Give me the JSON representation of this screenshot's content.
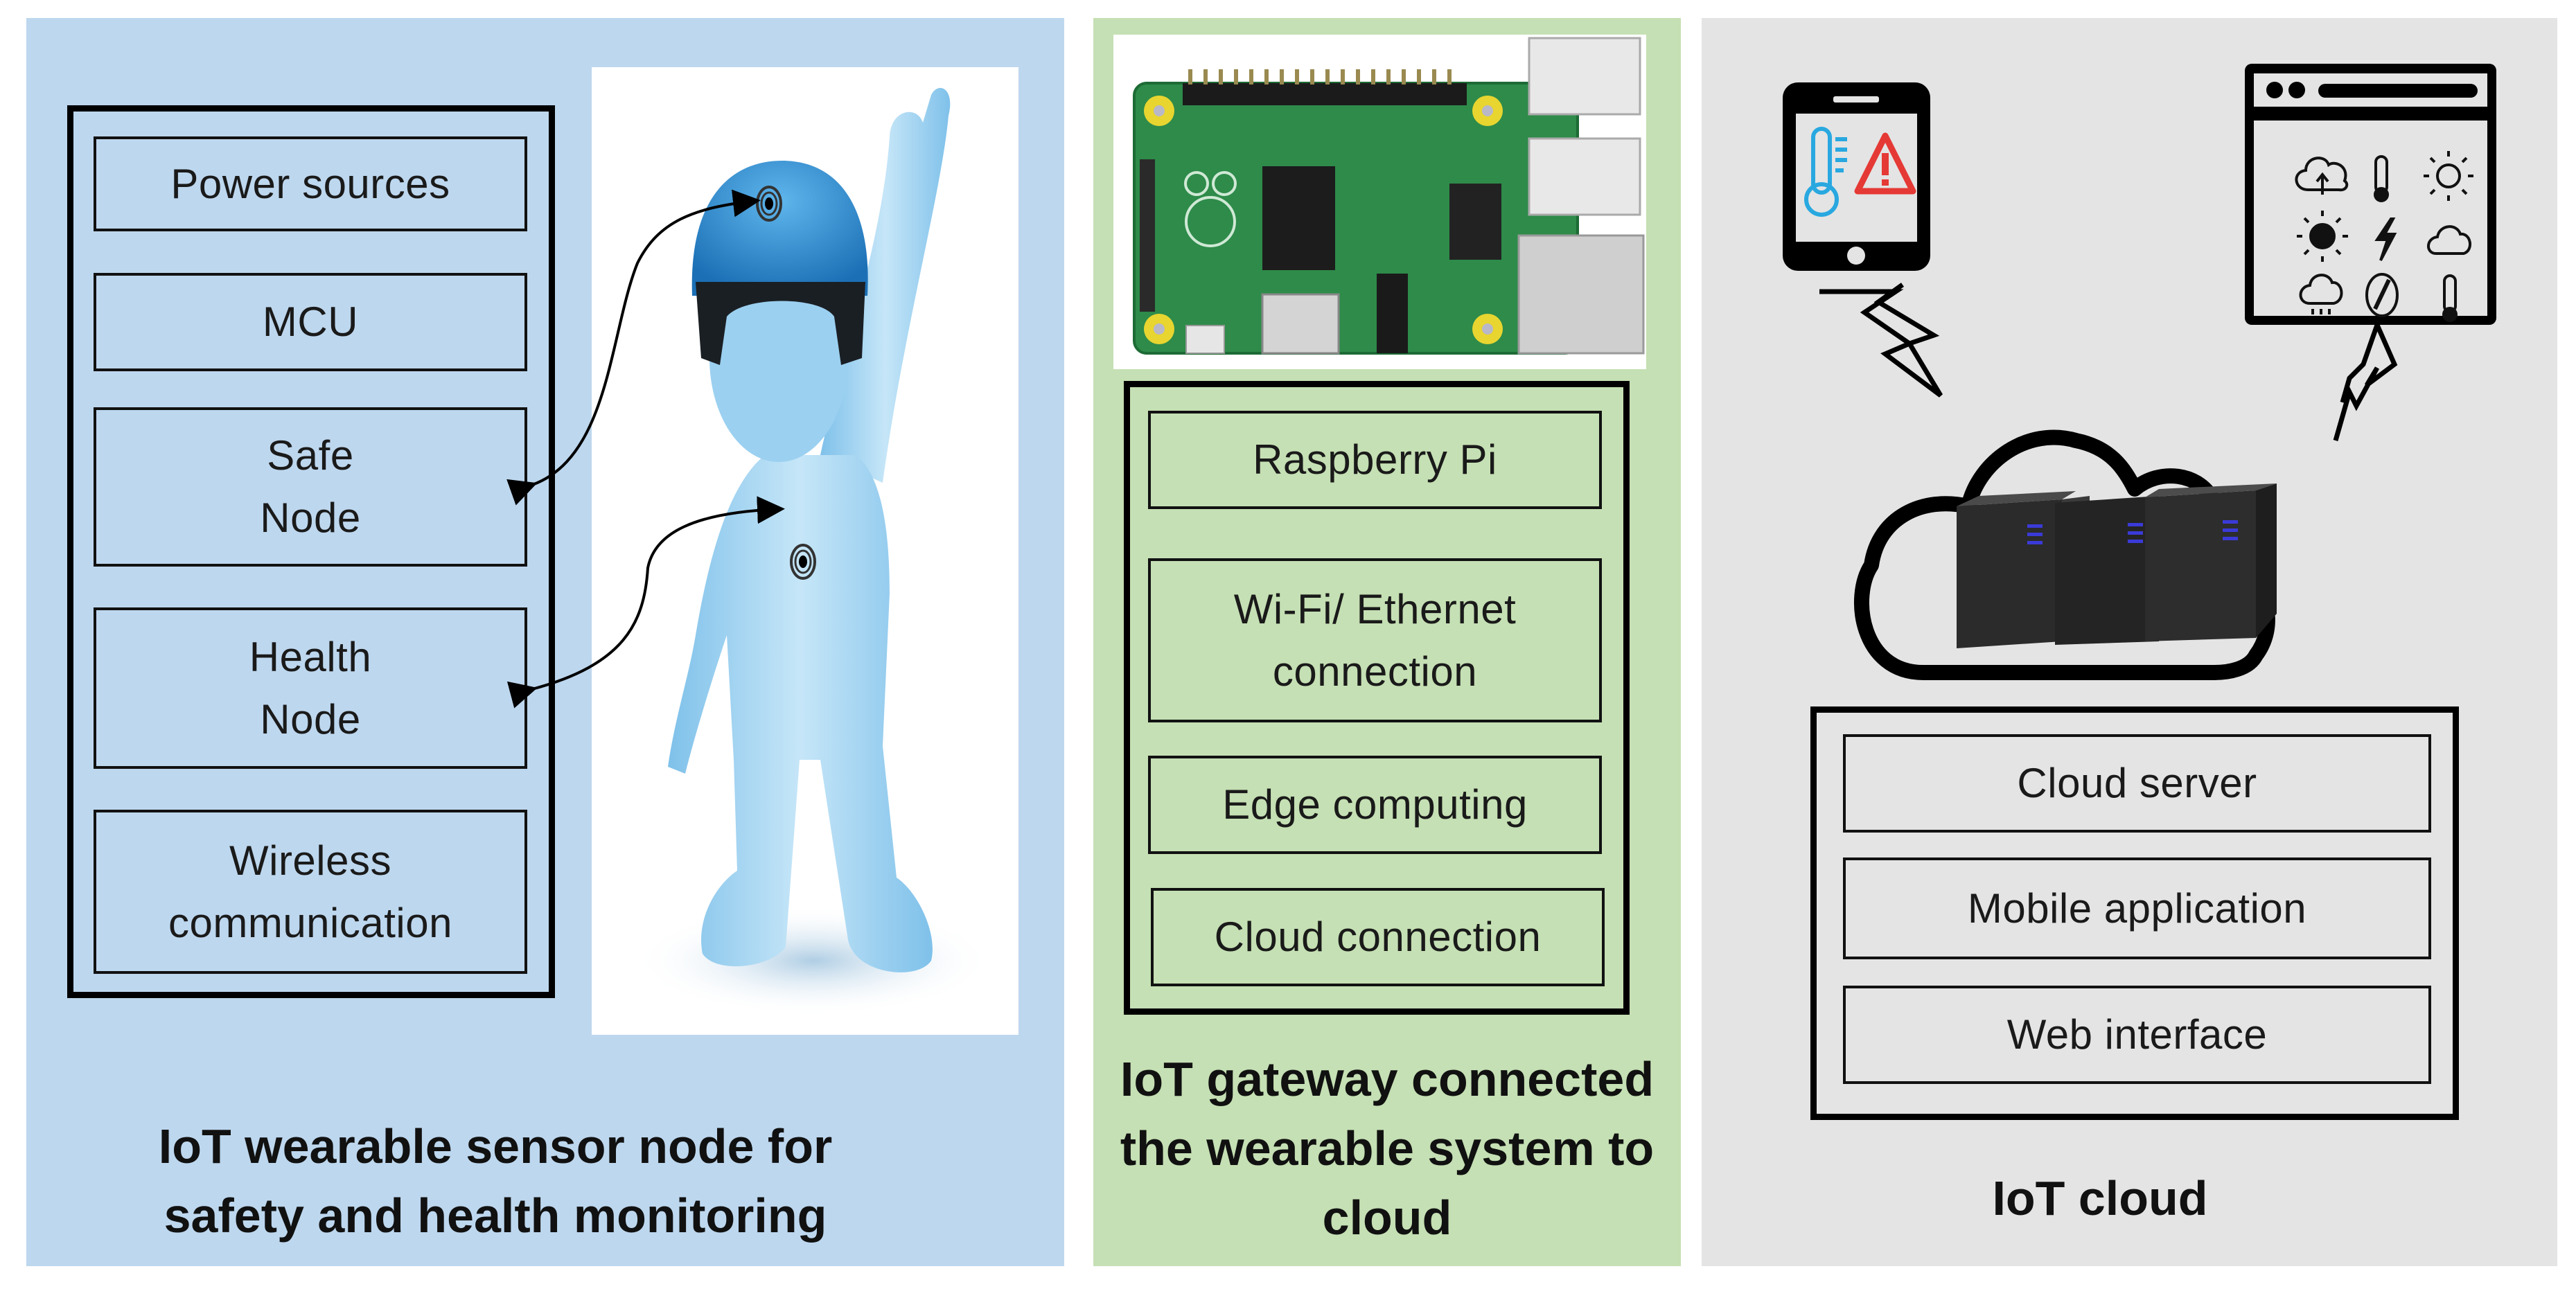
{
  "panels": {
    "wearable": {
      "title": "IoT wearable sensor node for\nsafety and health monitoring",
      "background": "#bdd7ee",
      "components": [
        {
          "label": "Power sources"
        },
        {
          "label": "MCU"
        },
        {
          "label": "Safe\nNode"
        },
        {
          "label": "Health\nNode"
        },
        {
          "label": "Wireless\ncommunication"
        }
      ],
      "figure": "blue-humanoid-with-helmet-icon",
      "sensor_links": [
        {
          "from": "helmet-sensor",
          "to": "Safe Node"
        },
        {
          "from": "chest-sensor",
          "to": "Health Node"
        }
      ]
    },
    "gateway": {
      "title": "IoT gateway connected\nthe wearable system to\ncloud",
      "background": "#c5e0b4",
      "image": "raspberry-pi-board-icon",
      "components": [
        {
          "label": "Raspberry Pi"
        },
        {
          "label": "Wi-Fi/ Ethernet\nconnection"
        },
        {
          "label": "Edge computing"
        },
        {
          "label": "Cloud connection"
        }
      ]
    },
    "cloud": {
      "title": "IoT cloud",
      "background": "#e4e4e4",
      "illustration": {
        "phone": "smartphone-icon",
        "phone_screen_icons": [
          "thermometer-icon",
          "warning-icon"
        ],
        "browser": "browser-window-icon",
        "browser_icons": [
          "cloud-upload-icon",
          "thermometer-icon",
          "sun-outline-icon",
          "sun-filled-icon",
          "lightning-icon",
          "cloud-icon",
          "rain-cloud-icon",
          "compass-icon",
          "thermometer-icon"
        ],
        "cloud": "cloud-with-servers-icon"
      },
      "components": [
        {
          "label": "Cloud server"
        },
        {
          "label": "Mobile application"
        },
        {
          "label": "Web interface"
        }
      ]
    }
  },
  "colors": {
    "thermometer": "#29a8e0",
    "warning": "#e53935",
    "server_led": "#3a3ad8"
  }
}
